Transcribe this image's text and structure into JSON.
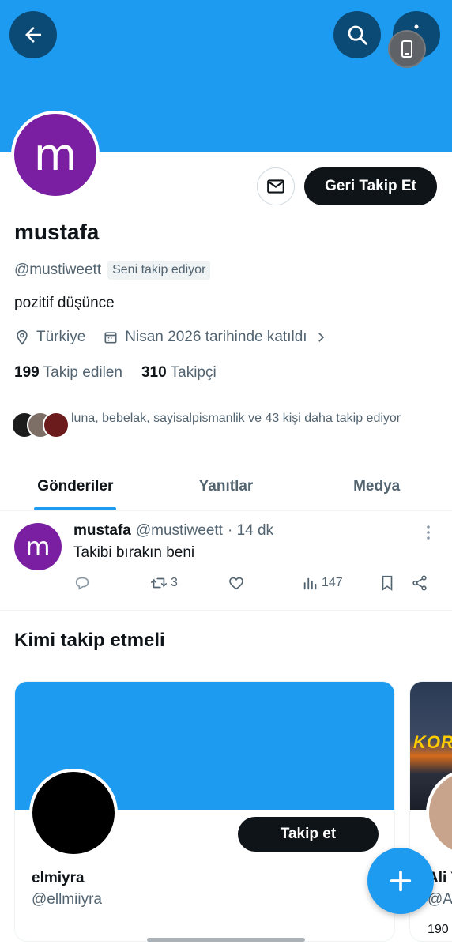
{
  "header": {
    "back_icon": "arrow-left-icon",
    "search_icon": "search-icon",
    "more_icon": "more-vertical-icon",
    "device_icon": "phone-icon",
    "banner_color": "#1d9bf0"
  },
  "profile": {
    "avatar_letter": "m",
    "avatar_color": "#7b1fa2",
    "name": "mustafa",
    "handle": "@mustiweett",
    "follows_you_badge": "Seni takip ediyor",
    "bio": "pozitif düşünce",
    "location": "Türkiye",
    "joined": "Nisan 2026 tarihinde katıldı",
    "following_count": "199",
    "following_label": "Takip edilen",
    "followers_count": "310",
    "followers_label": "Takipçi",
    "followed_by_text": "luna, bebelak, sayisalpismanlik ve 43 kişi daha takip ediyor"
  },
  "actions": {
    "message_icon": "mail-icon",
    "follow_back_label": "Geri Takip Et"
  },
  "tabs": [
    {
      "label": "Gönderiler",
      "active": true
    },
    {
      "label": "Yanıtlar",
      "active": false
    },
    {
      "label": "Medya",
      "active": false
    }
  ],
  "tweet": {
    "avatar_letter": "m",
    "name": "mustafa",
    "handle": "@mustiweett",
    "time": "· 14 dk",
    "text": "Takibi bırakın beni",
    "retweets": "3",
    "views": "147"
  },
  "who_to_follow": {
    "title": "Kimi takip etmeli",
    "cards": [
      {
        "name": "elmiyra",
        "handle": "@ellmiiyra",
        "follow_label": "Takip et"
      },
      {
        "name": "Ali Y",
        "handle": "@Al",
        "count": "190",
        "banner_text": "KOR"
      }
    ]
  },
  "fab_icon": "plus-icon"
}
